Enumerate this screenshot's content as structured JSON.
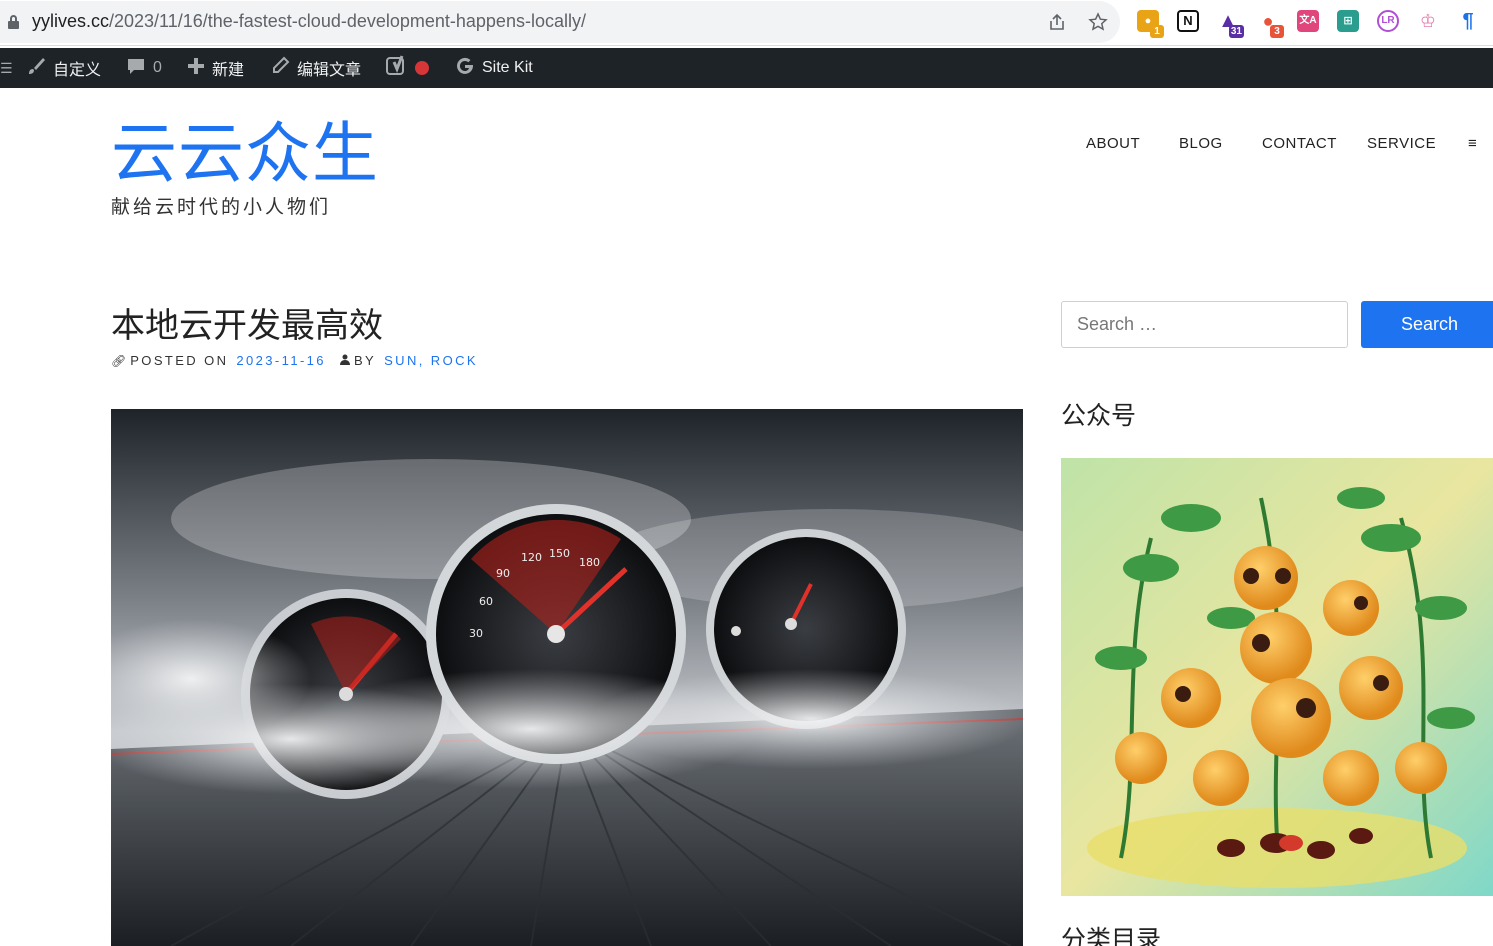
{
  "browser": {
    "url_host": "yylives.cc",
    "url_path": "/2023/11/16/the-fastest-cloud-development-happens-locally/",
    "extensions": [
      {
        "name": "chrome-ext-1",
        "badge": "1",
        "color": "#e8a317"
      },
      {
        "name": "notion-ext",
        "badge": "",
        "color": "#111111"
      },
      {
        "name": "ext-31",
        "badge": "31",
        "color": "#5a2ea6"
      },
      {
        "name": "ext-3",
        "badge": "3",
        "color": "#e8543a"
      },
      {
        "name": "translate-ext",
        "badge": "",
        "color": "#e0457b"
      },
      {
        "name": "ext-teal",
        "badge": "",
        "color": "#2a9d8f"
      },
      {
        "name": "ext-purple",
        "badge": "",
        "color": "#b04fd6"
      },
      {
        "name": "ext-pink",
        "badge": "",
        "color": "#e680b0"
      },
      {
        "name": "ext-blue",
        "badge": "",
        "color": "#1a73e8"
      }
    ]
  },
  "admin_bar": {
    "customize": "自定义",
    "comments_count": "0",
    "new": "新建",
    "edit_post": "编辑文章",
    "site_kit": "Site Kit"
  },
  "site": {
    "title": "云云众生",
    "tagline": "献给云时代的小人物们"
  },
  "nav": {
    "items": [
      "ABOUT",
      "BLOG",
      "CONTACT",
      "SERVICE"
    ],
    "menu_toggle": "≡"
  },
  "post": {
    "title": "本地云开发最高效",
    "posted_on_label": "POSTED ON",
    "date": "2023-11-16",
    "by_label": "BY",
    "authors": "SUN, ROCK"
  },
  "sidebar": {
    "search_placeholder": "Search …",
    "search_button": "Search",
    "widget1_title": "公众号",
    "widget2_title": "分类目录"
  },
  "colors": {
    "accent": "#1e73f0",
    "admin_bar": "#1d2327"
  }
}
